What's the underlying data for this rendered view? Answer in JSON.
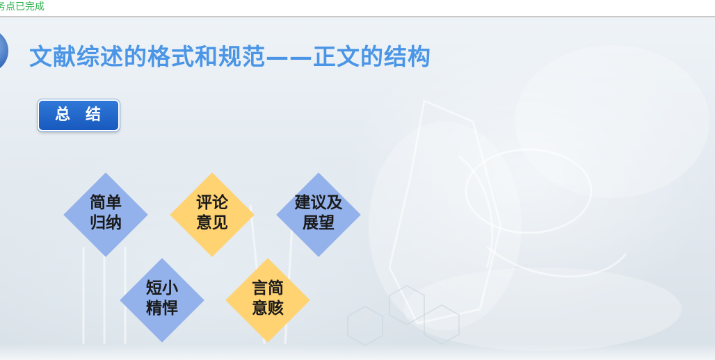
{
  "status": {
    "text": "务点已完成",
    "color": "#2bb24c"
  },
  "slide": {
    "title": "文献综述的格式和规范——正文的结构",
    "title_color": "#4a95e6",
    "summary_button": {
      "label": "总结",
      "color": "#1859bd"
    },
    "items": [
      {
        "line1": "简单",
        "line2": "归纳",
        "color": "#93b1ea"
      },
      {
        "line1": "评论",
        "line2": "意见",
        "color": "#ffd272"
      },
      {
        "line1": "建议及",
        "line2": "展望",
        "color": "#93b1ea"
      },
      {
        "line1": "短小",
        "line2": "精悍",
        "color": "#93b1ea"
      },
      {
        "line1": "言简",
        "line2": "意赅",
        "color": "#ffd272"
      }
    ]
  }
}
